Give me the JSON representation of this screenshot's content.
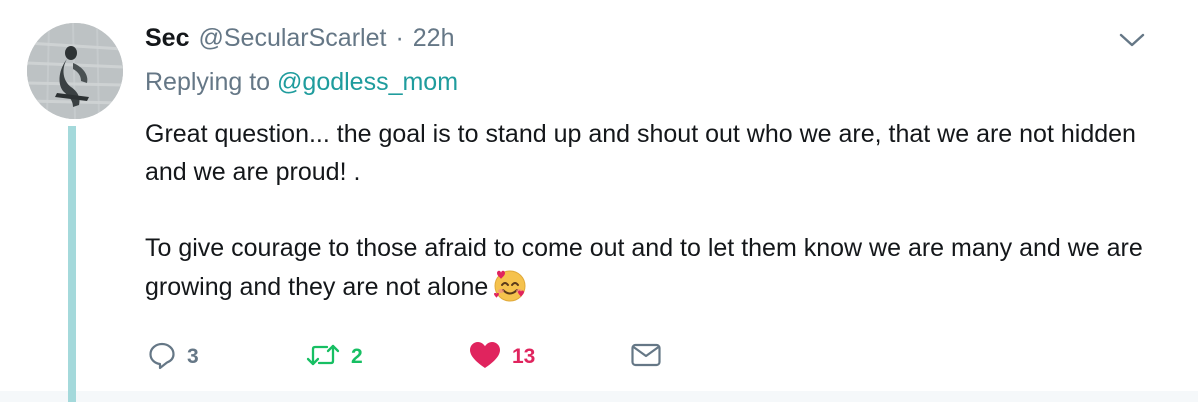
{
  "tweet": {
    "author": {
      "name": "Sec",
      "handle": "@SecularScarlet",
      "separator": "·",
      "time": "22h",
      "avatar_icon": "user-avatar"
    },
    "replying_to": {
      "prefix": "Replying to",
      "mention": "@godless_mom"
    },
    "text": {
      "paragraph1": "Great question... the goal is to stand up and shout out who we are, that we are not hidden and we are proud! .",
      "paragraph2": "To give courage to those afraid to come out and to let them know we are many and we are growing and they are not alone",
      "emoji_icon": "smiling-face-with-hearts-icon"
    },
    "actions": {
      "reply": {
        "icon": "reply-icon",
        "count": "3"
      },
      "retweet": {
        "icon": "retweet-icon",
        "count": "2"
      },
      "like": {
        "icon": "heart-icon",
        "count": "13",
        "liked": true
      },
      "dm": {
        "icon": "envelope-icon"
      }
    },
    "menu_icon": "chevron-down-icon"
  },
  "colors": {
    "text": "#14171a",
    "secondary": "#657786",
    "mention": "#1f9c9d",
    "thread_line": "#a4d9db",
    "retweet": "#17bf63",
    "like": "#e0245e"
  }
}
